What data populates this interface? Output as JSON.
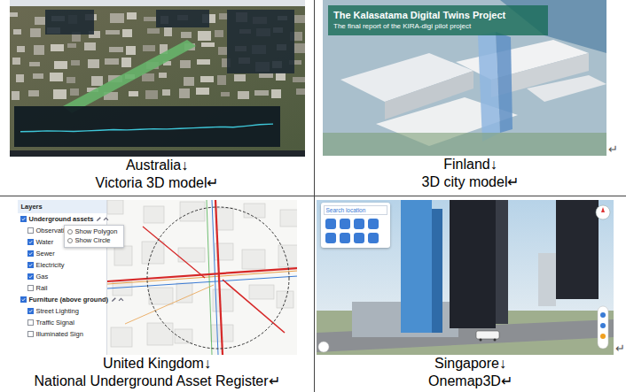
{
  "cells": [
    {
      "country": "Australia↓",
      "caption": "Victoria 3D model↵",
      "screen": {
        "kind": "aerial-dashboard",
        "profile": [
          0.35,
          0.36,
          0.38,
          0.37,
          0.36,
          0.38,
          0.4,
          0.42,
          0.41,
          0.43,
          0.45,
          0.44,
          0.46,
          0.48,
          0.5,
          0.52,
          0.51,
          0.55,
          0.6,
          0.62
        ]
      }
    },
    {
      "country": "Finland↓",
      "caption": "3D city model↵",
      "side_mark": "↵",
      "screen": {
        "kind": "report-cover",
        "title": "The Kalasatama Digital Twins Project",
        "subtitle": "The final report of the KIRA-digi pilot project"
      }
    },
    {
      "country": "United Kingdom↓",
      "caption": "National Underground Asset Register↵",
      "screen": {
        "kind": "layers-map",
        "panel_title": "Layers",
        "layers": [
          {
            "label": "Underground assets",
            "kind": "group",
            "checked": true
          },
          {
            "label": "Observati",
            "kind": "item",
            "checked": false
          },
          {
            "label": "Water",
            "kind": "item",
            "checked": true
          },
          {
            "label": "Sewer",
            "kind": "item",
            "checked": true
          },
          {
            "label": "Electricity",
            "kind": "item",
            "checked": true
          },
          {
            "label": "Gas",
            "kind": "item",
            "checked": true
          },
          {
            "label": "Rail",
            "kind": "item",
            "checked": false
          },
          {
            "label": "Furniture (above ground)",
            "kind": "group",
            "checked": true
          },
          {
            "label": "Street Lighting",
            "kind": "item",
            "checked": true
          },
          {
            "label": "Traffic Signal",
            "kind": "item",
            "checked": false
          },
          {
            "label": "Illuminated Sign",
            "kind": "item",
            "checked": false
          }
        ],
        "menu": [
          {
            "label": "Show Polygon",
            "selected": false
          },
          {
            "label": "Show Circle",
            "selected": false
          }
        ]
      }
    },
    {
      "country": "Singapore↓",
      "caption": "Onemap3D↵",
      "side_mark": "↵",
      "screen": {
        "kind": "city-3d",
        "search": {
          "placeholder": "Search location"
        }
      }
    }
  ]
}
